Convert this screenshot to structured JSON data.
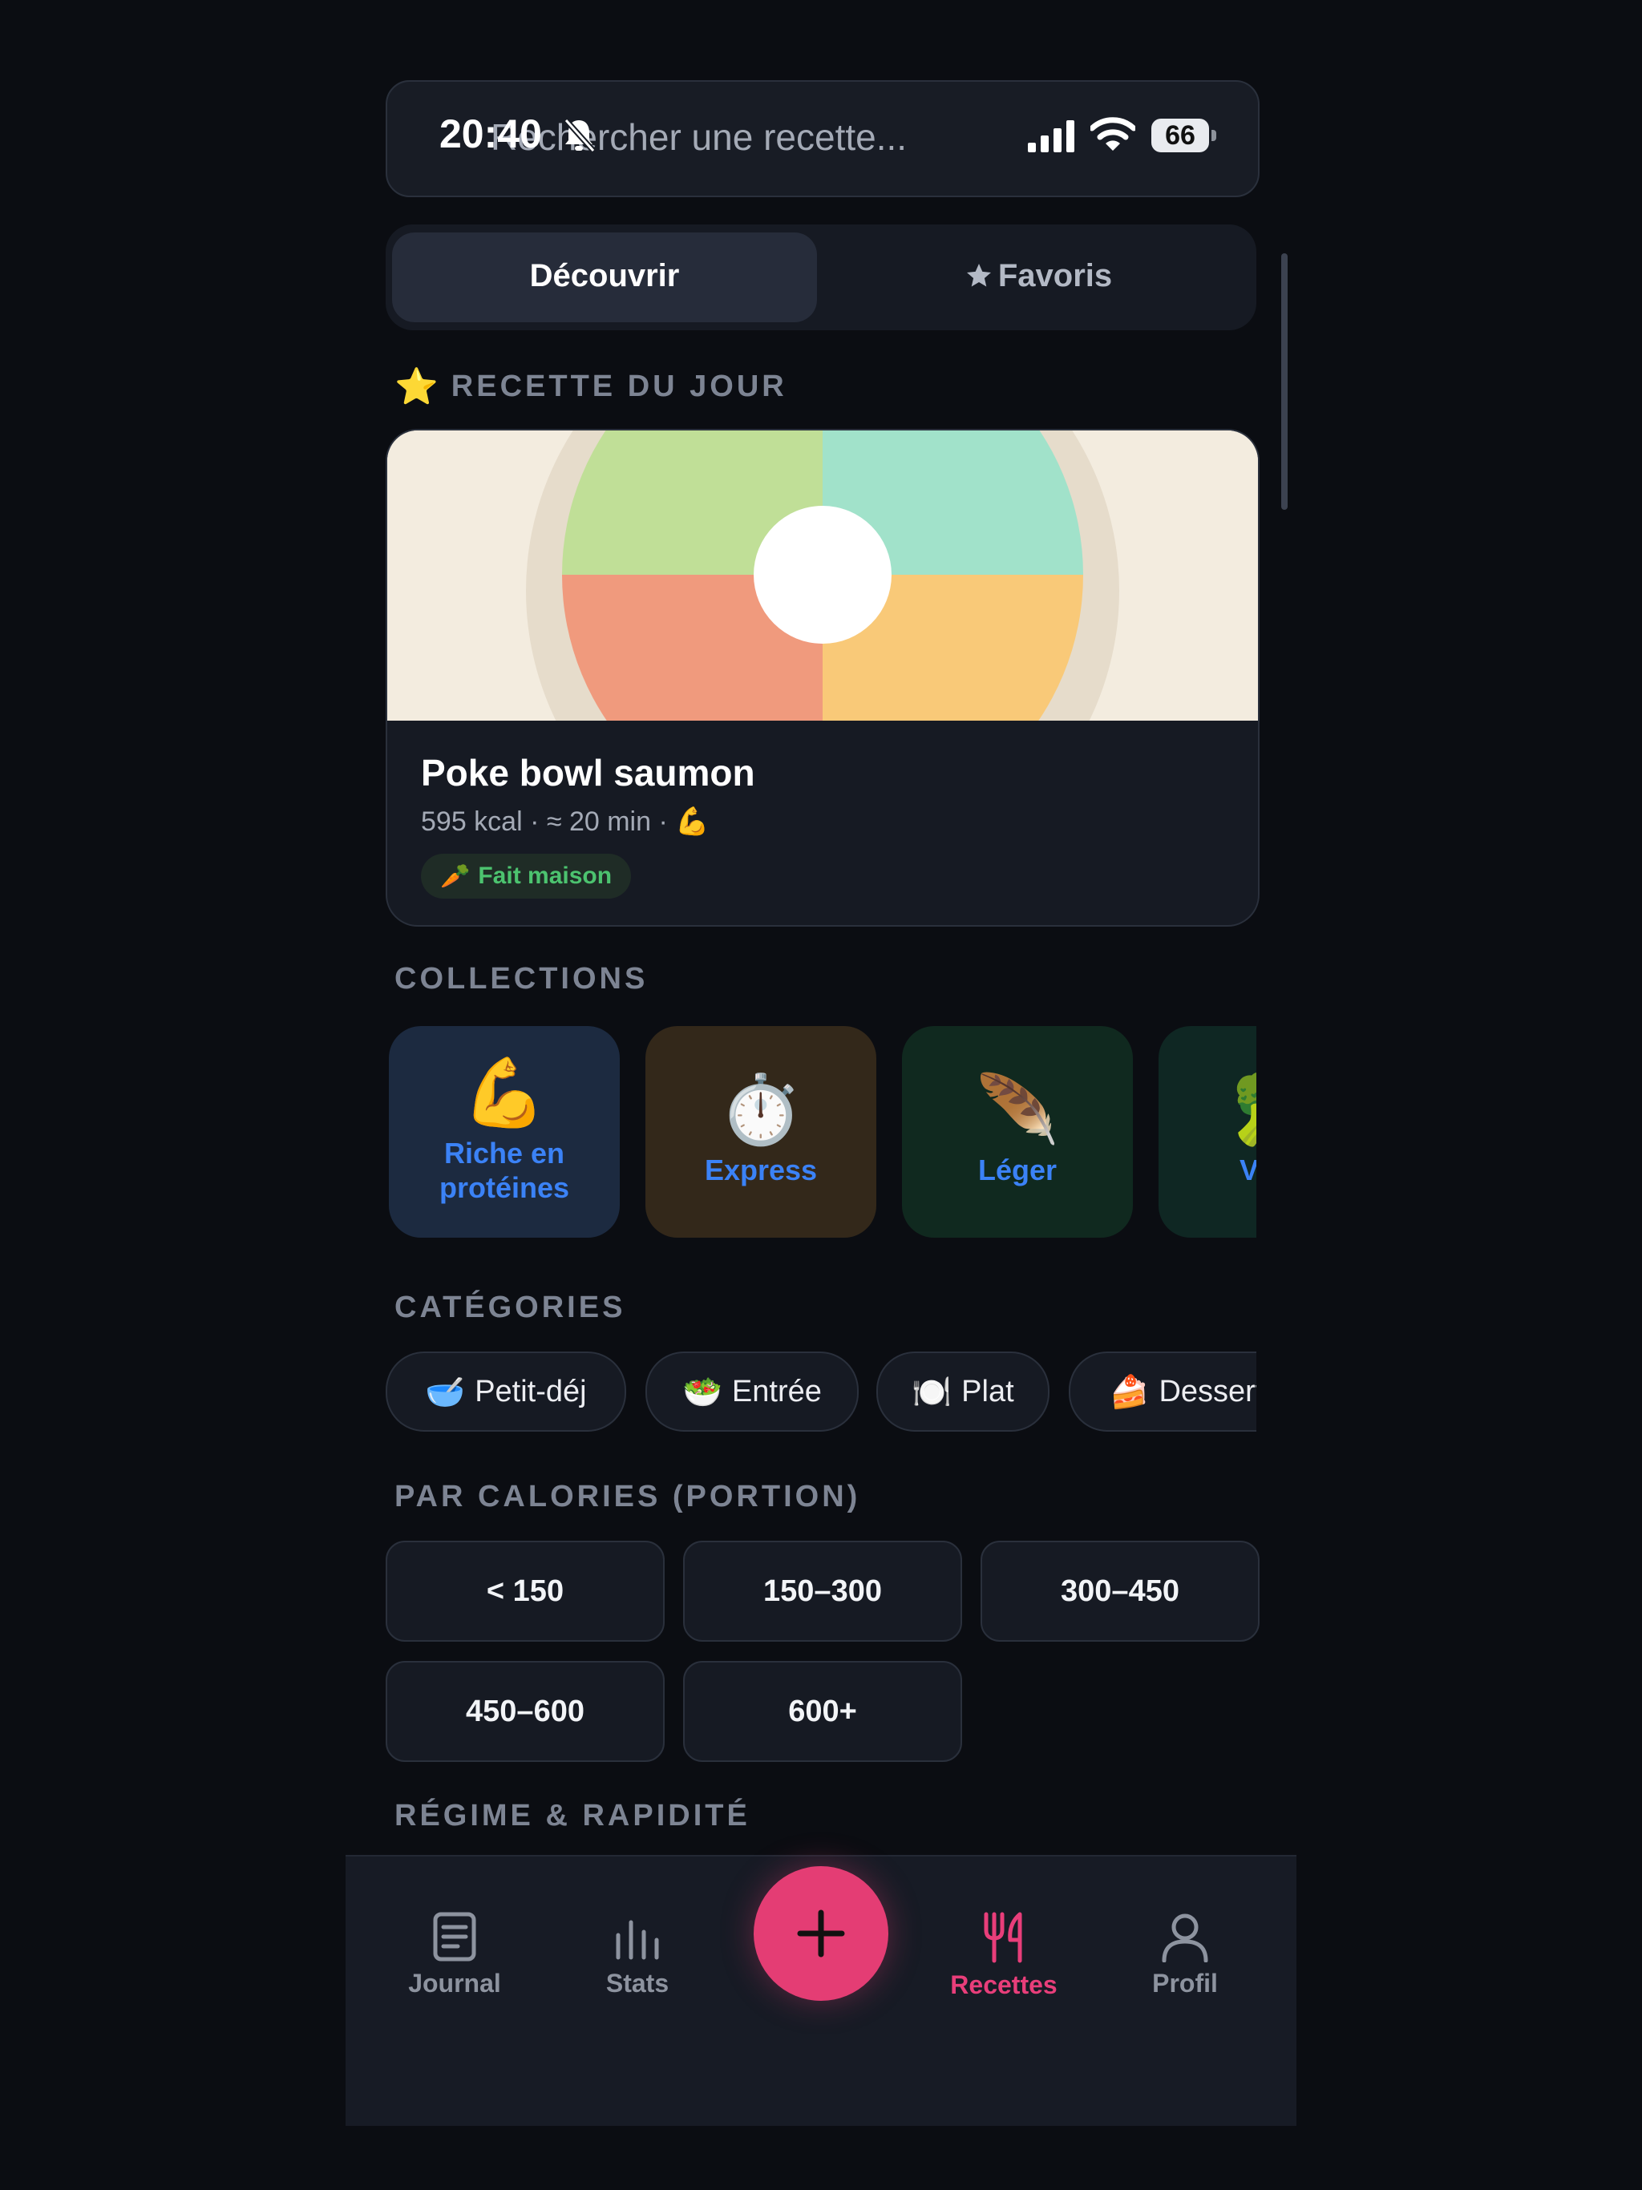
{
  "status_bar": {
    "time": "20:40",
    "battery": "66"
  },
  "search": {
    "placeholder": "Rechercher une recette..."
  },
  "segments": [
    {
      "label": "Découvrir",
      "active": true
    },
    {
      "label": "Favoris",
      "active": false,
      "icon": "star-icon"
    }
  ],
  "recipe_of_day": {
    "heading": "RECETTE DU JOUR",
    "heading_icon": "⭐",
    "title": "Poke bowl saumon",
    "meta": "595 kcal · ≈ 20 min · 💪",
    "tag": "Fait maison",
    "tag_icon": "🥕"
  },
  "collections": {
    "heading": "COLLECTIONS",
    "items": [
      {
        "emoji": "💪",
        "label": "Riche en protéines",
        "bg": "#1c2a40"
      },
      {
        "emoji": "⏱️",
        "label": "Express",
        "bg": "#33281a"
      },
      {
        "emoji": "🪶",
        "label": "Léger",
        "bg": "#10291f"
      },
      {
        "emoji": "🥦",
        "label": "Végé",
        "bg": "#0f2723"
      }
    ]
  },
  "categories": {
    "heading": "CATÉGORIES",
    "items": [
      {
        "emoji": "🥣",
        "label": "Petit-déj"
      },
      {
        "emoji": "🥗",
        "label": "Entrée"
      },
      {
        "emoji": "🍽️",
        "label": "Plat"
      },
      {
        "emoji": "🍰",
        "label": "Dessert"
      }
    ]
  },
  "calories": {
    "heading": "PAR CALORIES (PORTION)",
    "items": [
      "< 150",
      "150–300",
      "300–450",
      "450–600",
      "600+"
    ]
  },
  "diet_heading": "RÉGIME & RAPIDITÉ",
  "tabbar": {
    "items": [
      {
        "label": "Journal",
        "icon": "document-icon"
      },
      {
        "label": "Stats",
        "icon": "bar-chart-icon"
      },
      {
        "label": "Recettes",
        "icon": "fork-knife-icon",
        "active": true
      },
      {
        "label": "Profil",
        "icon": "person-icon"
      }
    ],
    "fab_icon": "plus-icon"
  },
  "colors": {
    "background": "#0b0d12",
    "accent": "#e43d74",
    "link_blue": "#3b82f6",
    "tag_green": "#4cc36f"
  }
}
